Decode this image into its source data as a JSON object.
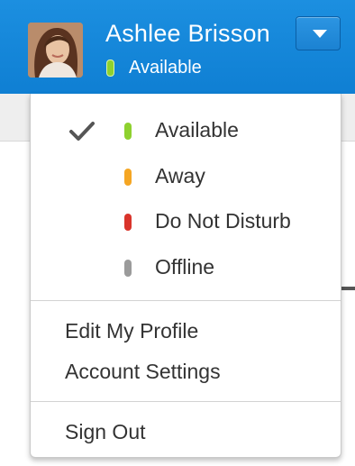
{
  "user": {
    "name": "Ashlee Brisson",
    "status": "Available",
    "status_color": "#8ed12f"
  },
  "menu": {
    "statuses": [
      {
        "label": "Available",
        "color": "#8ed12f",
        "selected": true
      },
      {
        "label": "Away",
        "color": "#f5a623",
        "selected": false
      },
      {
        "label": "Do Not Disturb",
        "color": "#d9342b",
        "selected": false
      },
      {
        "label": "Offline",
        "color": "#9b9b9b",
        "selected": false
      }
    ],
    "actions": [
      {
        "label": "Edit My Profile"
      },
      {
        "label": "Account Settings"
      }
    ],
    "sign_out": "Sign Out"
  },
  "icons": {
    "checkmark": "check-icon",
    "dropdown": "caret-down-icon",
    "avatar": "user-photo"
  },
  "colors": {
    "header_blue": "#1588db",
    "text": "#333333"
  }
}
